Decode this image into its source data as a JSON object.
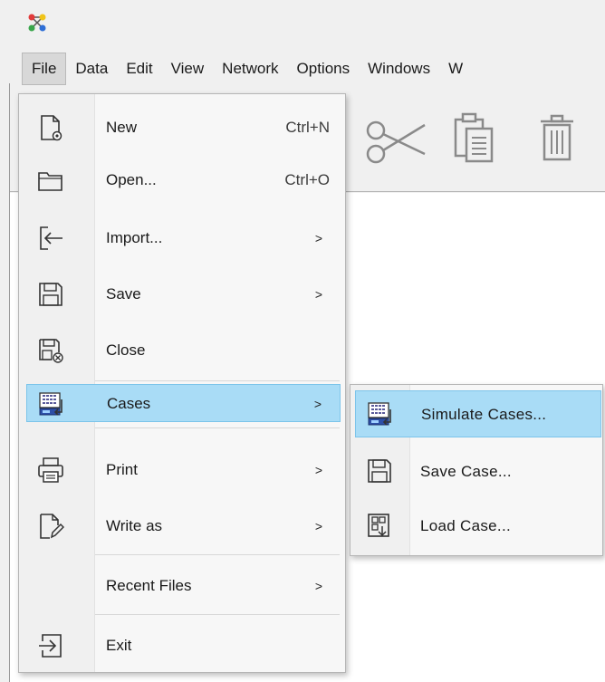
{
  "menubar": {
    "items": [
      {
        "label": "File"
      },
      {
        "label": "Data"
      },
      {
        "label": "Edit"
      },
      {
        "label": "View"
      },
      {
        "label": "Network"
      },
      {
        "label": "Options"
      },
      {
        "label": "Windows"
      },
      {
        "label": "W"
      }
    ]
  },
  "file_menu": {
    "items": [
      {
        "label": "New",
        "shortcut": "Ctrl+N",
        "icon": "new-file-icon"
      },
      {
        "label": "Open...",
        "shortcut": "Ctrl+O",
        "icon": "folder-icon"
      },
      {
        "label": "Import...",
        "arrow": ">",
        "icon": "import-icon"
      },
      {
        "label": "Save",
        "arrow": ">",
        "icon": "save-icon"
      },
      {
        "label": "Close",
        "icon": "close-file-icon"
      },
      {
        "label": "Cases",
        "arrow": ">",
        "icon": "cases-icon",
        "highlighted": true
      },
      {
        "label": "Print",
        "arrow": ">",
        "icon": "printer-icon"
      },
      {
        "label": "Write as",
        "arrow": ">",
        "icon": "write-as-icon"
      },
      {
        "label": "Recent Files",
        "arrow": ">"
      },
      {
        "label": "Exit",
        "icon": "exit-icon"
      }
    ]
  },
  "cases_submenu": {
    "items": [
      {
        "label": "Simulate Cases...",
        "icon": "simulate-cases-icon",
        "highlighted": true
      },
      {
        "label": "Save Case...",
        "icon": "save-icon"
      },
      {
        "label": "Load Case...",
        "icon": "load-case-icon"
      }
    ]
  },
  "colors": {
    "highlight": "#a9dcf6",
    "highlight_border": "#7cc4ea",
    "menu_bg": "#f7f7f7",
    "gutter_bg": "#f0f0f0"
  }
}
